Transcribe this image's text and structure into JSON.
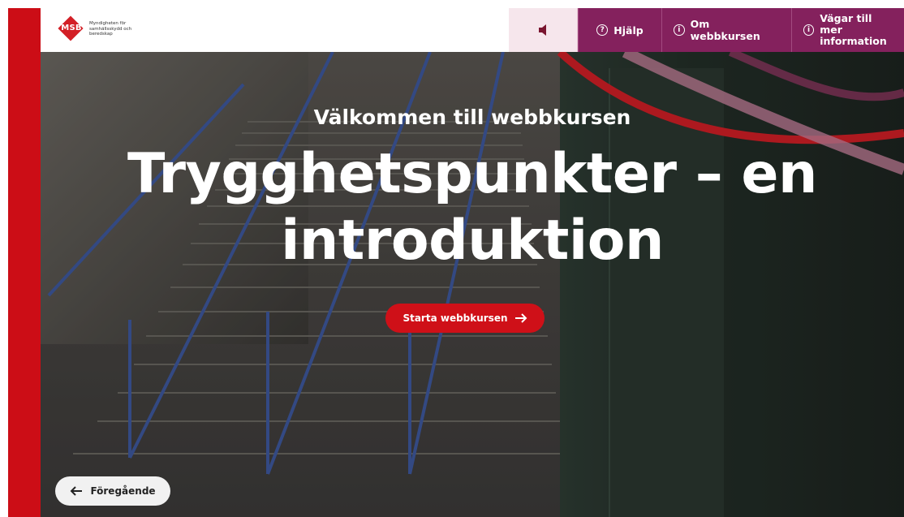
{
  "header": {
    "logo_text": "MSB",
    "logo_caption": "Myndigheten för samhällsskydd och beredskap"
  },
  "nav": {
    "sound_icon": "speaker-icon",
    "help_label": "Hjälp",
    "about_label": "Om webbkursen",
    "more_info_line1": "Vägar till mer",
    "more_info_line2": "information"
  },
  "hero": {
    "subtitle": "Välkommen till webbkursen",
    "title": "Trygghetspunkter – en introduktion",
    "start_button_label": "Starta webbkursen",
    "previous_button_label": "Föregående"
  },
  "colors": {
    "brand_red": "#cc0d16",
    "nav_purple": "#84215d",
    "sound_bg": "#f6e6ec"
  }
}
